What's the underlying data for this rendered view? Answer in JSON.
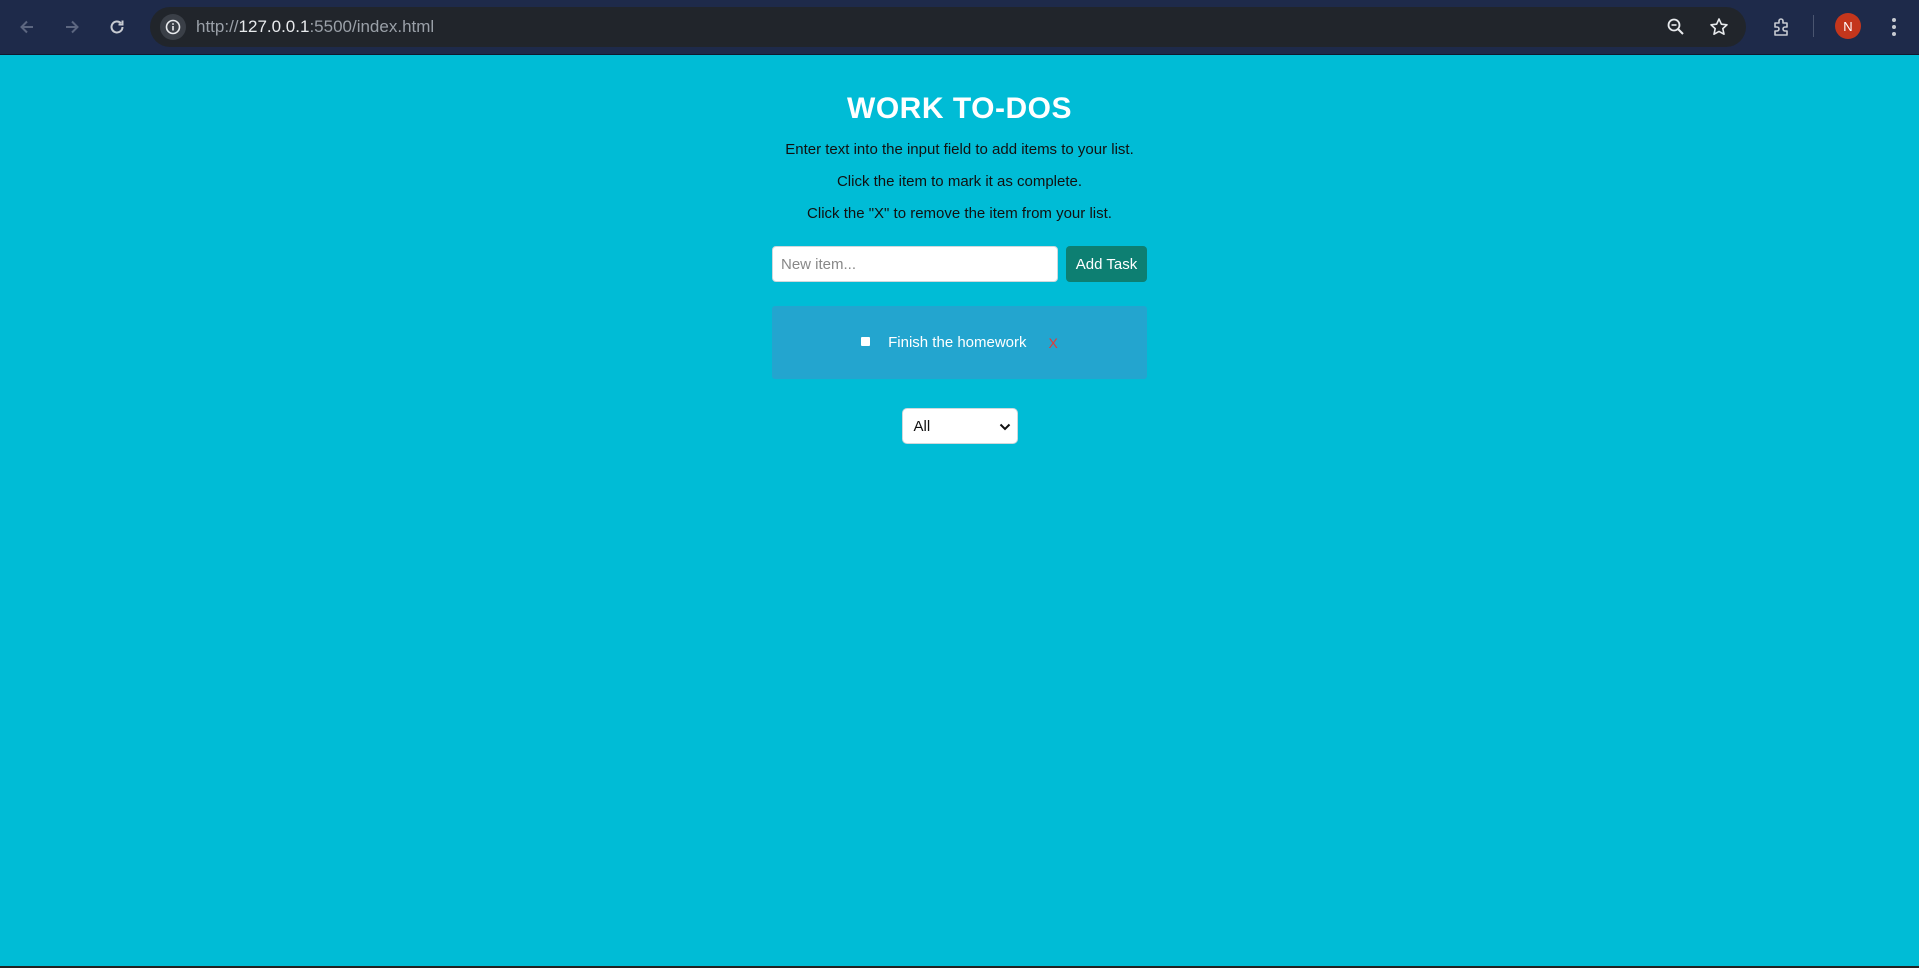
{
  "browser": {
    "url_scheme": "http://",
    "url_host": "127.0.0.1",
    "url_rest": ":5500/index.html",
    "profile_initial": "N"
  },
  "app": {
    "title": "WORK TO-DOS",
    "instructions": [
      "Enter text into the input field to add items to your list.",
      "Click the item to mark it as complete.",
      "Click the \"X\" to remove the item from your list."
    ],
    "input": {
      "placeholder": "New item...",
      "value": ""
    },
    "add_button_label": "Add Task",
    "tasks": [
      {
        "text": "Finish the homework",
        "remove_label": "X",
        "completed": false
      }
    ],
    "filter": {
      "selected": "All"
    }
  },
  "colors": {
    "page_bg": "#00bcd6",
    "task_list_bg": "#23a5cf",
    "add_button": "#0d7f72",
    "remove_x": "#e53935",
    "chrome_bg": "#1e2a4a"
  }
}
